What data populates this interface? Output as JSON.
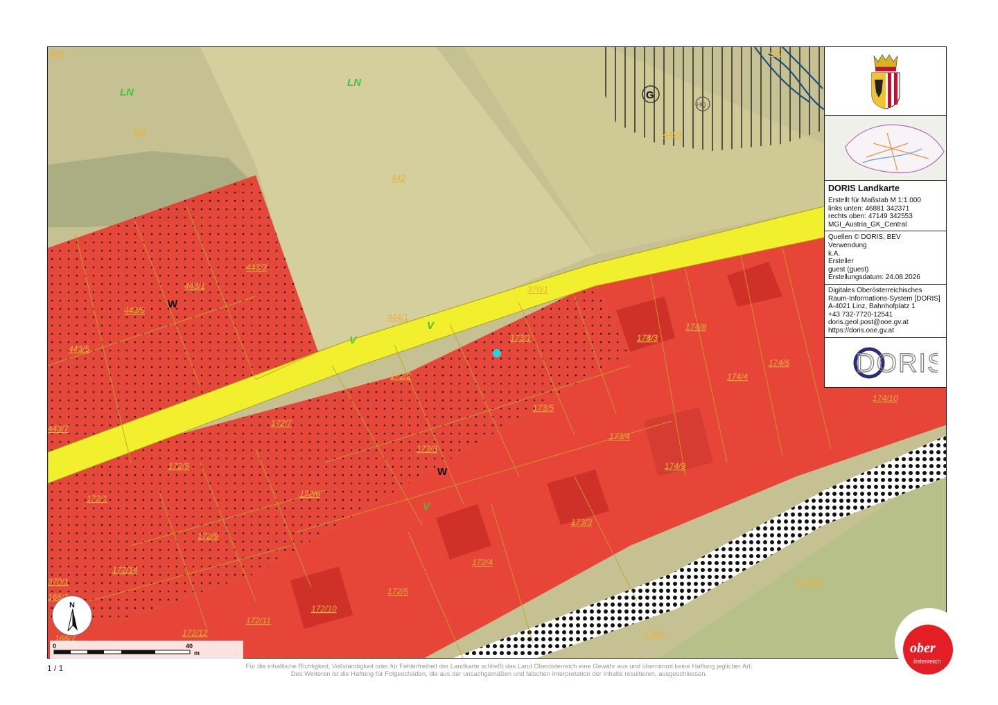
{
  "panel": {
    "title": "DORIS Landkarte",
    "scale_text": "Erstellt für Maßstab M 1:1.000",
    "bottom_left": "links unten: 46881 342371",
    "top_right": "rechts oben: 47149 342553",
    "projection": "MGI_Austria_GK_Central",
    "sources": "Quellen © DORIS, BEV",
    "usage_label": "Verwendung",
    "usage_value": "k.A.",
    "creator_label": "Ersteller",
    "creator_value": "guest (guest)",
    "created_date": "Erstellungsdatum: 24.08.2026",
    "org_line1": "Digitales Oberösterreichisches",
    "org_line2": "Raum-Informations-System [DORIS]",
    "org_address": "A-4021 Linz, Bahnhofplatz 1",
    "org_phone": "+43 732-7720-12541",
    "org_email": "doris.geol.post@ooe.gv.at",
    "org_web": "https://doris.ooe.gv.at",
    "doris_logo_text": "DORIS"
  },
  "map": {
    "zones": [
      "LN",
      "LN",
      "V",
      "V",
      "V",
      "W",
      "W",
      "G",
      "HQ"
    ],
    "parcels": [
      "448",
      "442",
      "442",
      "443/3",
      "443/1",
      "443/6",
      "443/5",
      "443/7",
      "370/1",
      "444/1",
      "173/1",
      "172/2",
      "173/3",
      "173/5",
      "172/7",
      "172/3",
      "173/4",
      "174/3",
      "174/8",
      "174/5",
      "174/4",
      "174/10",
      "172/8",
      "172/1",
      "172/6",
      "174/9",
      "172/9",
      "173/3",
      "172/14",
      "172/4",
      "172/5",
      "370/1",
      "166/1",
      "172/10",
      "172/11",
      "172/12",
      "166/7",
      "174/12",
      "174/9",
      "407",
      "4459"
    ],
    "colors": {
      "residential": "#e83b30",
      "road": "#f2ef2e",
      "agriculture": "#c9c490",
      "green_label": "#3fc43f",
      "parcel_label": "#e8b23a"
    }
  },
  "scalebar": {
    "start": "0",
    "end": "40",
    "unit": "m"
  },
  "north_label": "N",
  "page_number": "1 / 1",
  "disclaimer_line1": "Für die inhaltliche Richtigkeit, Vollständigkeit oder für Fehlerfreiheit der Landkarte schließt das Land Oberösterreich eine Gewähr aus und übernimmt keine Haftung jeglicher Art.",
  "disclaimer_line2": "Des Weiteren ist die Haftung für Folgeschäden, die aus der unsachgemäßen und falschen Interpretation der Inhalte resultieren, ausgeschlossen.",
  "ober_logo": {
    "line1": "ober",
    "line2": "österreich"
  }
}
